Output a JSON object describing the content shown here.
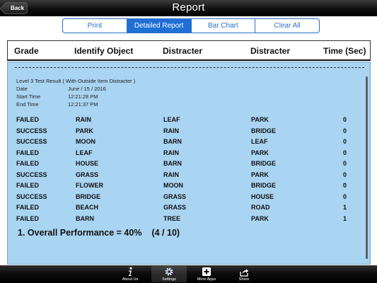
{
  "nav": {
    "title": "Report",
    "back_label": "Back"
  },
  "segments": [
    {
      "label": "Print",
      "active": false
    },
    {
      "label": "Detailed Report",
      "active": true
    },
    {
      "label": "Bar Chart",
      "active": false
    },
    {
      "label": "Clear All",
      "active": false
    }
  ],
  "columns": [
    "Grade",
    "Identify Object",
    "Distracter",
    "Distracter",
    "Time (Sec)"
  ],
  "report": {
    "title": "Level 3 Test Result ( With Outside Item Distracter )",
    "date_label": "Date",
    "date_value": "June / 15 / 2016",
    "start_label": "Start Time",
    "start_value": "12:21:28 PM",
    "end_label": "End Time",
    "end_value": "12:21:37 PM"
  },
  "rows": [
    {
      "grade": "FAILED",
      "object": "RAIN",
      "d1": "LEAF",
      "d2": "PARK",
      "time": "0"
    },
    {
      "grade": "SUCCESS",
      "object": "PARK",
      "d1": "RAIN",
      "d2": "BRIDGE",
      "time": "0"
    },
    {
      "grade": "SUCCESS",
      "object": "MOON",
      "d1": "BARN",
      "d2": "LEAF",
      "time": "0"
    },
    {
      "grade": "FAILED",
      "object": "LEAF",
      "d1": "RAIN",
      "d2": "PARK",
      "time": "0"
    },
    {
      "grade": "FAILED",
      "object": "HOUSE",
      "d1": "BARN",
      "d2": "BRIDGE",
      "time": "0"
    },
    {
      "grade": "SUCCESS",
      "object": "GRASS",
      "d1": "RAIN",
      "d2": "PARK",
      "time": "0"
    },
    {
      "grade": "FAILED",
      "object": "FLOWER",
      "d1": "MOON",
      "d2": "BRIDGE",
      "time": "0"
    },
    {
      "grade": "SUCCESS",
      "object": "BRIDGE",
      "d1": "GRASS",
      "d2": "HOUSE",
      "time": "0"
    },
    {
      "grade": "FAILED",
      "object": "BEACH",
      "d1": "GRASS",
      "d2": "ROAD",
      "time": "1"
    },
    {
      "grade": "FAILED",
      "object": "BARN",
      "d1": "TREE",
      "d2": "PARK",
      "time": "1"
    }
  ],
  "performance": {
    "text": "1.  Overall Performance = 40%",
    "ratio": "(4 / 10)"
  },
  "tabs": [
    {
      "label": "About Us",
      "icon": "info-icon"
    },
    {
      "label": "Settings",
      "icon": "gear-icon"
    },
    {
      "label": "More Apps",
      "icon": "plus-icon"
    },
    {
      "label": "Share",
      "icon": "share-icon"
    }
  ],
  "colors": {
    "accent": "#1f6fd6",
    "panel": "#a9d4f2"
  }
}
